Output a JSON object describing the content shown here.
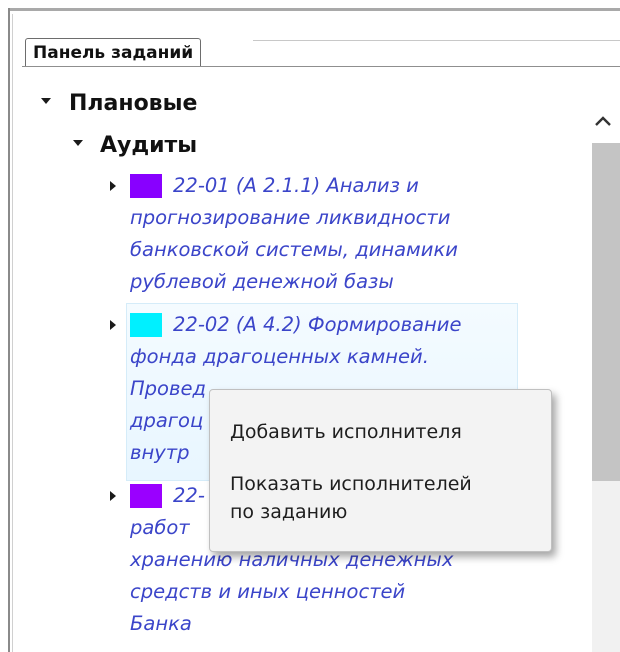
{
  "panel": {
    "title": "Панель заданий"
  },
  "tree": {
    "group": {
      "label": "Плановые"
    },
    "subgroup": {
      "label": "Аудиты"
    },
    "items": [
      {
        "color": "#8800ff",
        "lines": [
          "22-01 (А 2.1.1) Анализ и",
          "прогнозирование ликвидности",
          "банковской системы, динамики",
          "рублевой денежной базы"
        ]
      },
      {
        "color": "#00f0ff",
        "lines": [
          "22-02 (А 4.2) Формирование",
          "фонда драгоценных камней.",
          "Провед",
          "драгоц",
          "внутр"
        ]
      },
      {
        "color": "#9a00ff",
        "lines": [
          "22-",
          "работ",
          "хранению наличных денежных",
          "средств и иных ценностей",
          "Банка"
        ]
      }
    ]
  },
  "context_menu": {
    "items": [
      {
        "label": "Добавить исполнителя"
      },
      {
        "label_line1": "Показать исполнителей",
        "label_line2": "по заданию"
      }
    ]
  },
  "scrollbar": {
    "up_icon": "chevron-up-icon"
  }
}
